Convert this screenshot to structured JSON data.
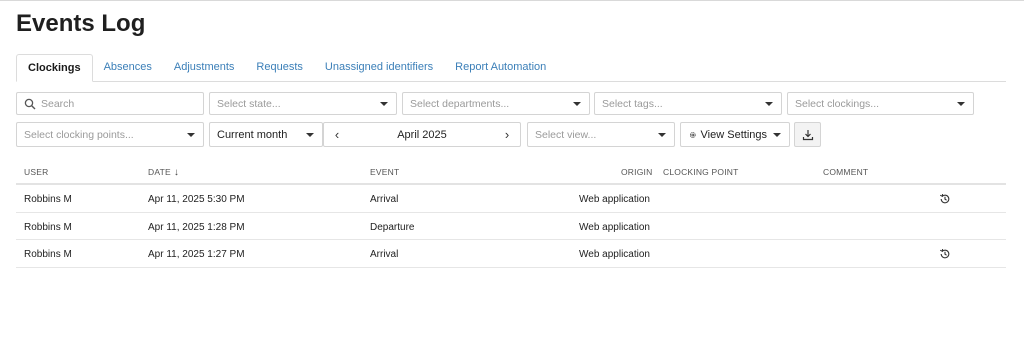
{
  "page": {
    "title": "Events Log"
  },
  "tabs": [
    {
      "label": "Clockings",
      "active": true
    },
    {
      "label": "Absences"
    },
    {
      "label": "Adjustments"
    },
    {
      "label": "Requests"
    },
    {
      "label": "Unassigned identifiers"
    },
    {
      "label": "Report Automation"
    }
  ],
  "filters": {
    "search_placeholder": "Search",
    "state_placeholder": "Select state...",
    "departments_placeholder": "Select departments...",
    "tags_placeholder": "Select tags...",
    "clockings_placeholder": "Select clockings...",
    "clocking_points_placeholder": "Select clocking points...",
    "period_value": "Current month",
    "month_label": "April 2025",
    "view_placeholder": "Select view...",
    "view_settings_label": "View Settings"
  },
  "table": {
    "headers": {
      "user": "USER",
      "date": "DATE",
      "event": "EVENT",
      "origin": "ORIGIN",
      "clocking_point": "CLOCKING POINT",
      "comment": "COMMENT"
    },
    "date_sort_arrow": "↓",
    "rows": [
      {
        "user": "Robbins M",
        "date": "Apr 11, 2025 5:30 PM",
        "event": "Arrival",
        "origin": "Web application",
        "clocking_point": "",
        "comment": "",
        "has_history": true
      },
      {
        "user": "Robbins M",
        "date": "Apr 11, 2025 1:28 PM",
        "event": "Departure",
        "origin": "Web application",
        "clocking_point": "",
        "comment": "",
        "has_history": false
      },
      {
        "user": "Robbins M",
        "date": "Apr 11, 2025 1:27 PM",
        "event": "Arrival",
        "origin": "Web application",
        "clocking_point": "",
        "comment": "",
        "has_history": true
      }
    ]
  },
  "colors": {
    "link": "#3b7fb8",
    "border": "#d4d4d4"
  },
  "icons": {
    "search": "search-icon",
    "gear": "gear-icon",
    "download": "download-icon",
    "history": "history-icon",
    "chevron_left": "chevron-left-icon",
    "chevron_right": "chevron-right-icon"
  }
}
